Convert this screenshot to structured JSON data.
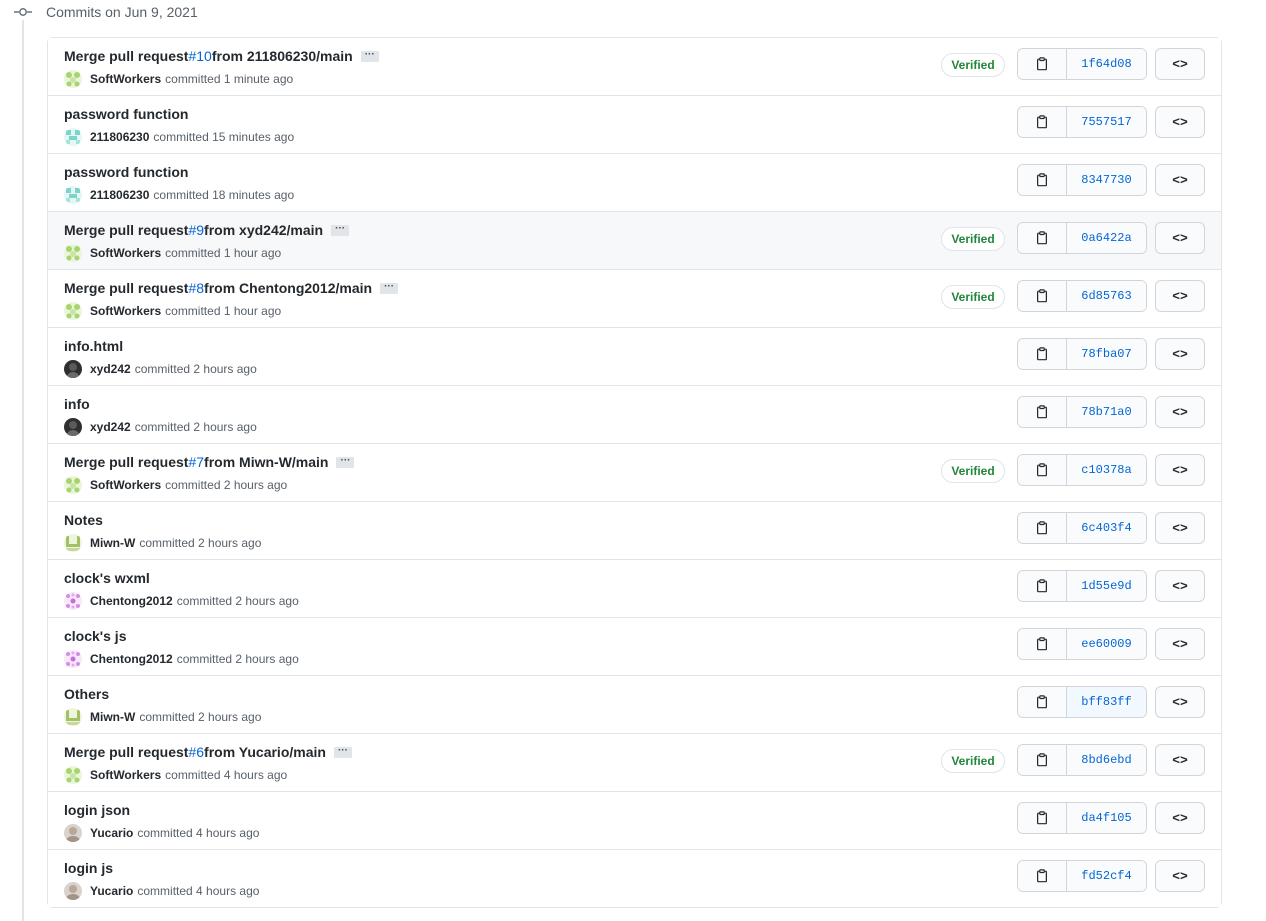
{
  "group": {
    "title": "Commits on Jun 9, 2021"
  },
  "verified_label": "Verified",
  "browse_label": "<>",
  "commits": [
    {
      "message": "Merge pull request ",
      "pr": "#10",
      "suffix": " from 211806230/main",
      "has_ellipsis": true,
      "author": "SoftWorkers",
      "time": "committed 1 minute ago",
      "verified": true,
      "sha": "1f64d08",
      "avatar": "softworkers"
    },
    {
      "message": "password function",
      "pr": "",
      "suffix": "",
      "has_ellipsis": false,
      "author": "211806230",
      "time": "committed 15 minutes ago",
      "verified": false,
      "sha": "7557517",
      "avatar": "teal"
    },
    {
      "message": "password function",
      "pr": "",
      "suffix": "",
      "has_ellipsis": false,
      "author": "211806230",
      "time": "committed 18 minutes ago",
      "verified": false,
      "sha": "8347730",
      "avatar": "teal"
    },
    {
      "message": "Merge pull request ",
      "pr": "#9",
      "suffix": " from xyd242/main",
      "has_ellipsis": true,
      "author": "SoftWorkers",
      "time": "committed 1 hour ago",
      "verified": true,
      "sha": "0a6422a",
      "avatar": "softworkers",
      "hover": true
    },
    {
      "message": "Merge pull request ",
      "pr": "#8",
      "suffix": " from Chentong2012/main",
      "has_ellipsis": true,
      "author": "SoftWorkers",
      "time": "committed 1 hour ago",
      "verified": true,
      "sha": "6d85763",
      "avatar": "softworkers"
    },
    {
      "message": "info.html",
      "pr": "",
      "suffix": "",
      "has_ellipsis": false,
      "author": "xyd242",
      "time": "committed 2 hours ago",
      "verified": false,
      "sha": "78fba07",
      "avatar": "dark"
    },
    {
      "message": "info",
      "pr": "",
      "suffix": "",
      "has_ellipsis": false,
      "author": "xyd242",
      "time": "committed 2 hours ago",
      "verified": false,
      "sha": "78b71a0",
      "avatar": "dark"
    },
    {
      "message": "Merge pull request ",
      "pr": "#7",
      "suffix": " from Miwn-W/main",
      "has_ellipsis": true,
      "author": "SoftWorkers",
      "time": "committed 2 hours ago",
      "verified": true,
      "sha": "c10378a",
      "avatar": "softworkers"
    },
    {
      "message": "Notes",
      "pr": "",
      "suffix": "",
      "has_ellipsis": false,
      "author": "Miwn-W",
      "time": "committed 2 hours ago",
      "verified": false,
      "sha": "6c403f4",
      "avatar": "olive"
    },
    {
      "message": "clock's wxml",
      "pr": "",
      "suffix": "",
      "has_ellipsis": false,
      "author": "Chentong2012",
      "time": "committed 2 hours ago",
      "verified": false,
      "sha": "1d55e9d",
      "avatar": "purple"
    },
    {
      "message": "clock's js",
      "pr": "",
      "suffix": "",
      "has_ellipsis": false,
      "author": "Chentong2012",
      "time": "committed 2 hours ago",
      "verified": false,
      "sha": "ee60009",
      "avatar": "purple"
    },
    {
      "message": "Others",
      "pr": "",
      "suffix": "",
      "has_ellipsis": false,
      "author": "Miwn-W",
      "time": "committed 2 hours ago",
      "verified": false,
      "sha": "bff83ff",
      "avatar": "olive",
      "sha_active": true
    },
    {
      "message": "Merge pull request ",
      "pr": "#6",
      "suffix": " from Yucario/main",
      "has_ellipsis": true,
      "author": "SoftWorkers",
      "time": "committed 4 hours ago",
      "verified": true,
      "sha": "8bd6ebd",
      "avatar": "softworkers"
    },
    {
      "message": "login json",
      "pr": "",
      "suffix": "",
      "has_ellipsis": false,
      "author": "Yucario",
      "time": "committed 4 hours ago",
      "verified": false,
      "sha": "da4f105",
      "avatar": "photo"
    },
    {
      "message": "login js",
      "pr": "",
      "suffix": "",
      "has_ellipsis": false,
      "author": "Yucario",
      "time": "committed 4 hours ago",
      "verified": false,
      "sha": "fd52cf4",
      "avatar": "photo"
    }
  ],
  "colors": {
    "link": "#0366d6",
    "verified": "#22863a",
    "border": "#e1e4e8"
  }
}
